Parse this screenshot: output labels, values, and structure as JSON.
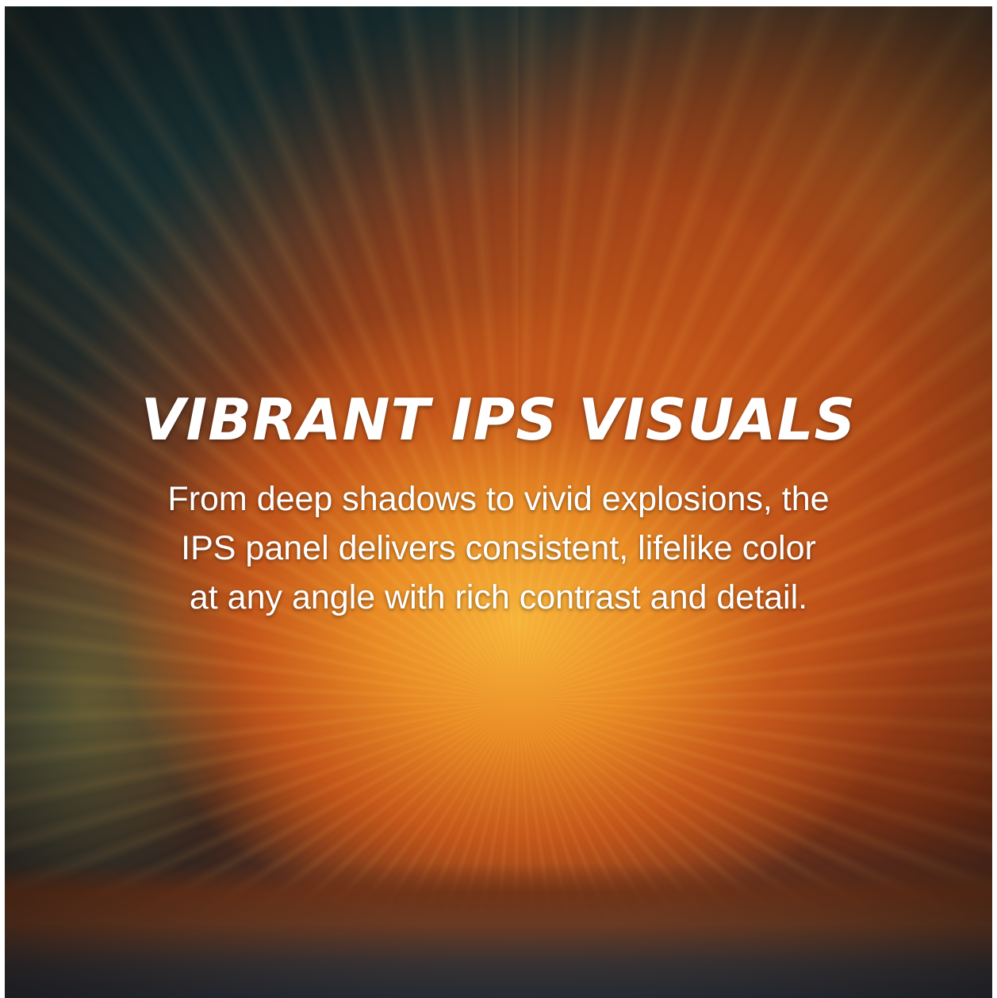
{
  "banner": {
    "title": "VIBRANT IPS VISUALS",
    "description_lines": [
      "From deep shadows to vivid explosions, the",
      "IPS panel delivers consistent, lifelike color",
      "at any angle with rich contrast and detail."
    ],
    "colors": {
      "text": "#ffffff",
      "explosion_core": "#f7b43a",
      "explosion_outer": "#c4561a",
      "smoke_teal": "#16383c"
    }
  }
}
